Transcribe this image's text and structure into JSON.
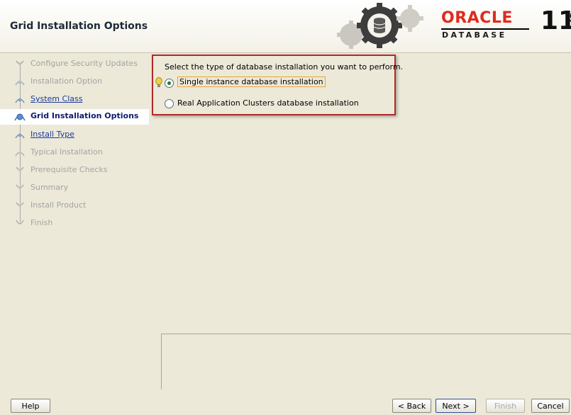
{
  "window": {
    "title": "Grid Installation Options"
  },
  "brand": {
    "oracle": "ORACLE",
    "database": "DATABASE",
    "version": "11",
    "version_suffix": "g",
    "accent": "#e02a1f"
  },
  "steps": [
    {
      "label": "Configure Security Updates",
      "state": "disabled"
    },
    {
      "label": "Installation Option",
      "state": "disabled"
    },
    {
      "label": "System Class",
      "state": "link"
    },
    {
      "label": "Grid Installation Options",
      "state": "current"
    },
    {
      "label": "Install Type",
      "state": "link"
    },
    {
      "label": "Typical Installation",
      "state": "disabled"
    },
    {
      "label": "Prerequisite Checks",
      "state": "disabled"
    },
    {
      "label": "Summary",
      "state": "disabled"
    },
    {
      "label": "Install Product",
      "state": "disabled"
    },
    {
      "label": "Finish",
      "state": "disabled"
    }
  ],
  "main": {
    "prompt": "Select the type of database installation you want to perform.",
    "options": [
      {
        "label": "Single instance database installation",
        "selected": true
      },
      {
        "label": "Real Application Clusters database installation",
        "selected": false
      }
    ]
  },
  "buttons": {
    "help": "Help",
    "back": "< Back",
    "next": "Next >",
    "finish": "Finish",
    "cancel": "Cancel"
  }
}
